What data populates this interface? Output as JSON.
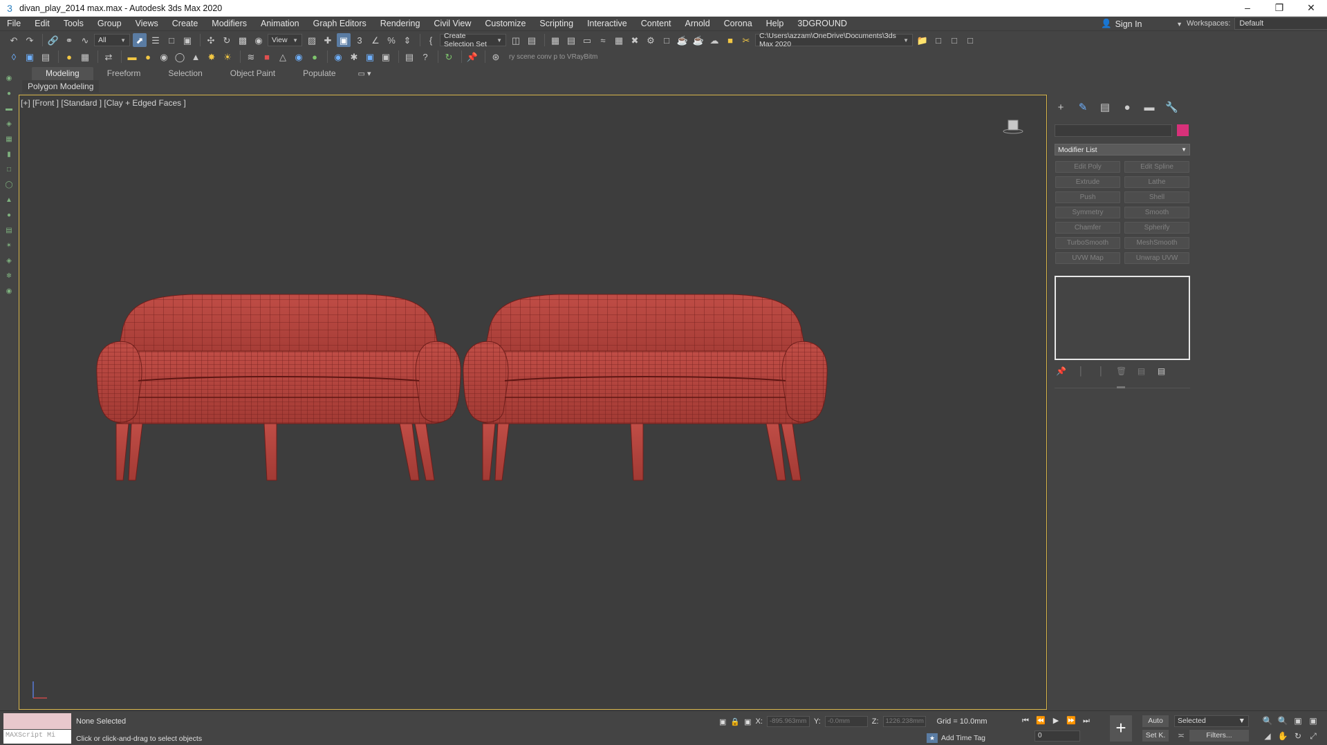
{
  "window": {
    "title": "divan_play_2014 max.max - Autodesk 3ds Max 2020",
    "app_icon": "3dsmax-icon",
    "controls": [
      "minimize-icon",
      "restore-icon",
      "close-icon"
    ]
  },
  "menu": {
    "items": [
      "File",
      "Edit",
      "Tools",
      "Group",
      "Views",
      "Create",
      "Modifiers",
      "Animation",
      "Graph Editors",
      "Rendering",
      "Civil View",
      "Customize",
      "Scripting",
      "Interactive",
      "Content",
      "Arnold",
      "Corona",
      "Help",
      "3DGROUND"
    ],
    "sign_in": "Sign In",
    "workspaces_label": "Workspaces:",
    "workspace_value": "Default"
  },
  "toolbar1": {
    "filter_value": "All",
    "ref_coord_value": "View",
    "selection_set_value": "Create Selection Set",
    "project_path": "C:\\Users\\azzam\\OneDrive\\Documents\\3ds Max 2020"
  },
  "toolbar2": {
    "hint": "ry scene conv p to VRayBitm"
  },
  "ribbon": {
    "tabs": [
      "Modeling",
      "Freeform",
      "Selection",
      "Object Paint",
      "Populate"
    ],
    "active_tab": "Modeling",
    "subpanel": "Polygon Modeling"
  },
  "viewport": {
    "label": "[+] [Front ] [Standard ] [Clay + Edged Faces ]",
    "object_color": "#b8453f",
    "wire_color": "#6e1e1b",
    "border_color": "#d9b64a"
  },
  "command_panel": {
    "tabs": [
      "create-icon",
      "modify-icon",
      "hierarchy-icon",
      "motion-icon",
      "display-icon",
      "utilities-icon"
    ],
    "active_tab": "modify-icon",
    "object_color": "#d8317a",
    "modifier_list_label": "Modifier List",
    "modifier_buttons": [
      "Edit Poly",
      "Edit Spline",
      "Extrude",
      "Lathe",
      "Push",
      "Shell",
      "Symmetry",
      "Smooth",
      "Chamfer",
      "Spherify",
      "TurboSmooth",
      "MeshSmooth",
      "UVW Map",
      "Unwrap UVW"
    ]
  },
  "status": {
    "selection": "None Selected",
    "prompt": "Click or click-and-drag to select objects",
    "maxscript": "MAXScript Mi",
    "x_label": "X:",
    "x_value": "-895.963mm",
    "y_label": "Y:",
    "y_value": "-0.0mm",
    "z_label": "Z:",
    "z_value": "1226.238mm",
    "grid": "Grid = 10.0mm",
    "add_time_tag": "Add Time Tag",
    "frame": "0",
    "auto_key": "Auto",
    "set_key": "Set K.",
    "key_filter": "Selected",
    "filters": "Filters..."
  }
}
